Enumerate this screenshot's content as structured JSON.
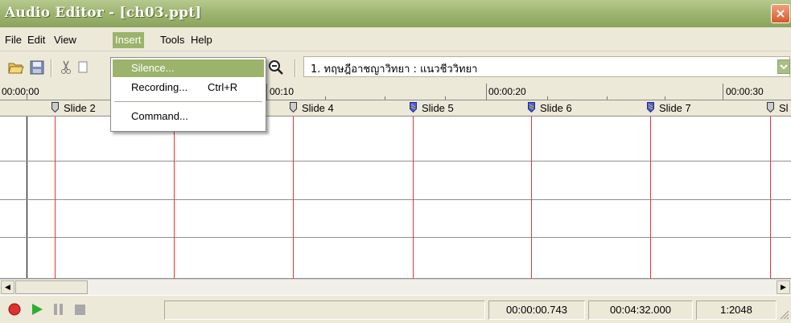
{
  "window": {
    "title": "Audio Editor - [ch03.ppt]",
    "close_glyph": "×"
  },
  "menubar": {
    "items": [
      "File",
      "Edit",
      "View",
      "Insert",
      "Tools",
      "Help"
    ],
    "active": "Insert"
  },
  "insert_menu": {
    "items": [
      {
        "label": "Silence...",
        "shortcut": ""
      },
      {
        "label": "Recording...",
        "shortcut": "Ctrl+R"
      },
      {
        "label": "Command...",
        "shortcut": ""
      }
    ],
    "highlighted": "Silence..."
  },
  "toolbar": {
    "icons": [
      "open-folder-icon",
      "save-icon",
      "cut-icon",
      "copy-icon",
      "zoom-out-icon"
    ],
    "slide_select_value": "1. ทฤษฎีอาชญาวิทยา : แนวชีววิทยา"
  },
  "ruler": {
    "labels": [
      "00:00:00",
      "00:00:10",
      "00:00:20",
      "00:00:30"
    ],
    "label_10_visible": "00:10"
  },
  "slides": [
    "Slide 2",
    "Slide 4",
    "Slide 5",
    "Slide 6",
    "Slide 7",
    "Sl"
  ],
  "status": {
    "position": "00:00:00.743",
    "duration": "00:04:32.000",
    "zoom": "1:2048"
  },
  "colors": {
    "accent": "#9cb36c",
    "titlebar": "#9fb673",
    "marker_line": "#e33333",
    "record": "#e03030",
    "play": "#2fae2f"
  }
}
